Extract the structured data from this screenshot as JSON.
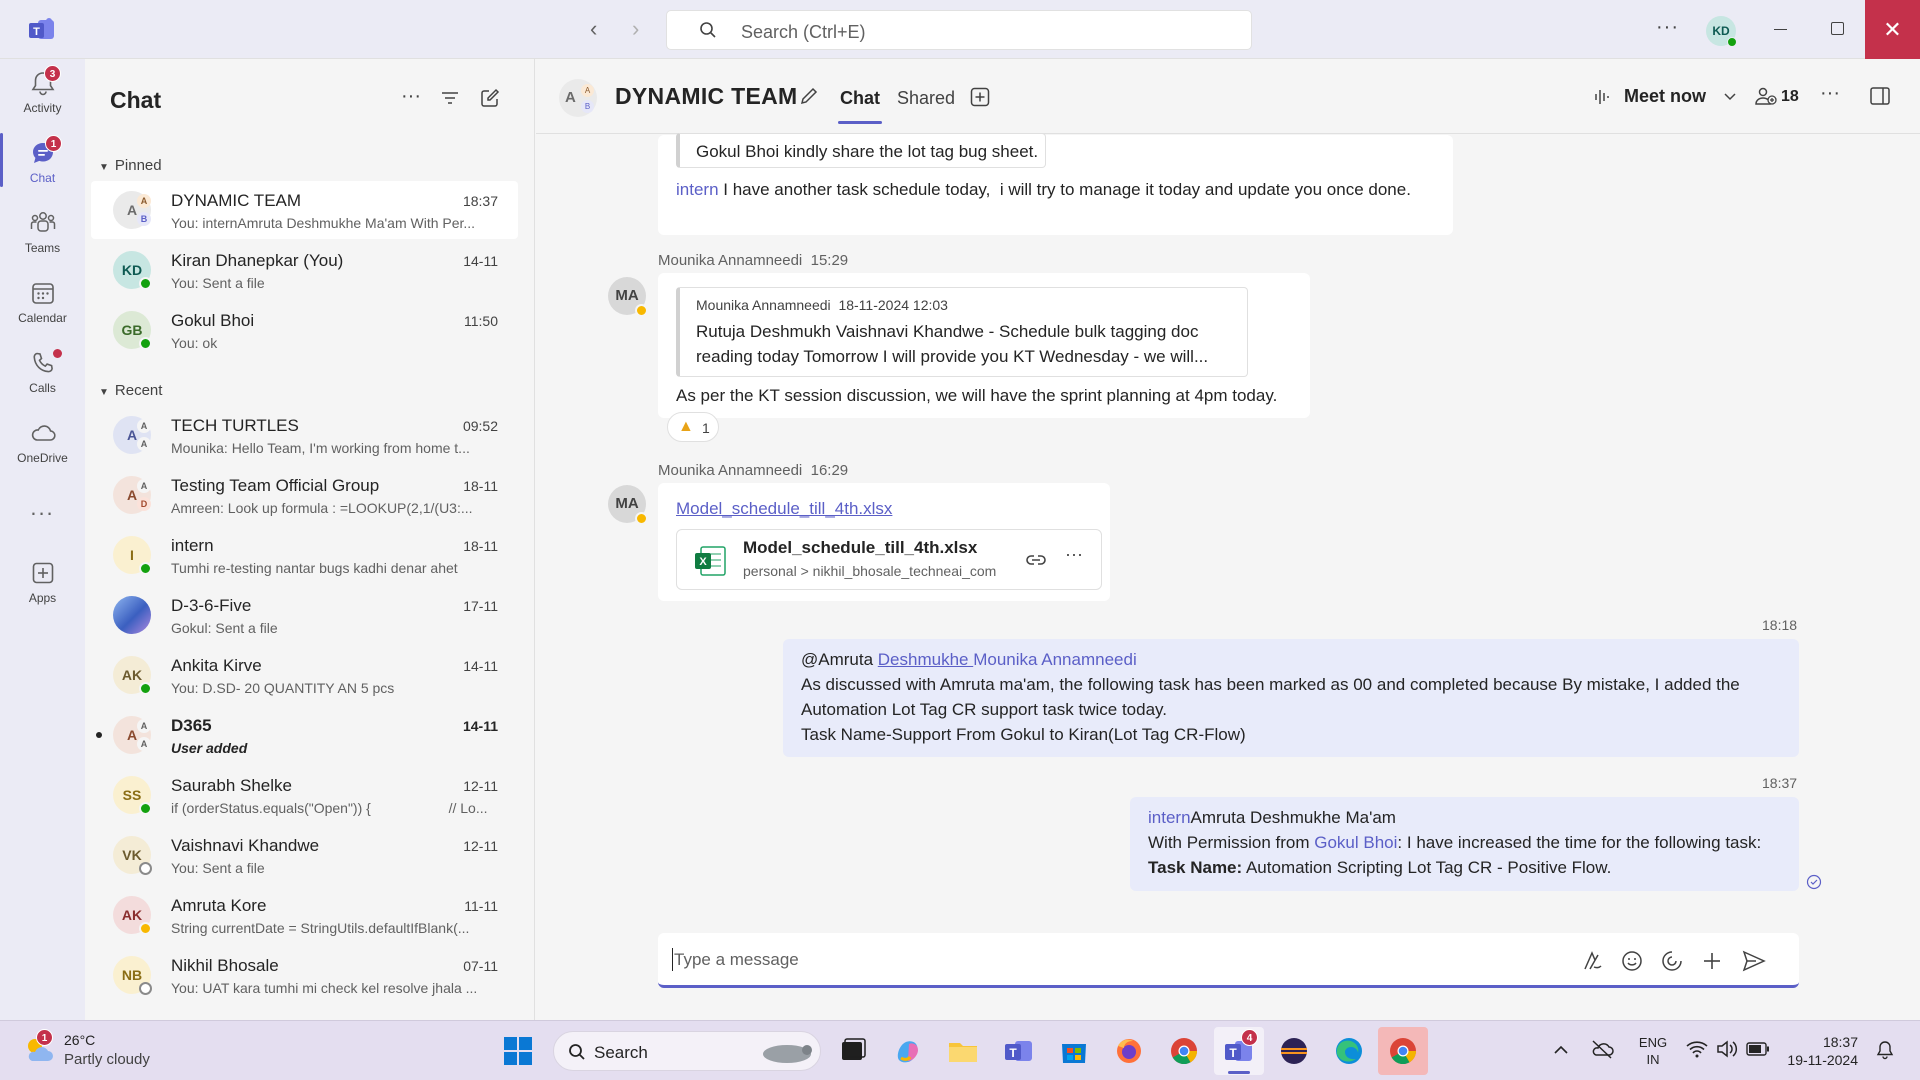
{
  "titlebar": {
    "search_placeholder": "Search (Ctrl+E)",
    "user_initials": "KD"
  },
  "rail": {
    "items": [
      {
        "label": "Activity",
        "badge": "3"
      },
      {
        "label": "Chat",
        "badge": "1"
      },
      {
        "label": "Teams"
      },
      {
        "label": "Calendar"
      },
      {
        "label": "Calls"
      },
      {
        "label": "OneDrive"
      },
      {
        "label": "Apps"
      }
    ],
    "more": "..."
  },
  "chatlist": {
    "title": "Chat",
    "pinned_label": "Pinned",
    "recent_label": "Recent",
    "pinned": [
      {
        "name": "DYNAMIC TEAM",
        "time": "18:37",
        "preview": "You: internAmruta Deshmukhe Ma'am With Per...",
        "initials": "A",
        "selected": true
      },
      {
        "name": "Kiran Dhanepkar (You)",
        "time": "14-11",
        "preview": "You: Sent a file",
        "initials": "KD"
      },
      {
        "name": "Gokul Bhoi",
        "time": "11:50",
        "preview": "You: ok",
        "initials": "GB"
      }
    ],
    "recent": [
      {
        "name": "TECH TURTLES",
        "time": "09:52",
        "preview": "Mounika: Hello Team, I'm working from home t...",
        "initials": "A"
      },
      {
        "name": "Testing Team Official Group",
        "time": "18-11",
        "preview": "Amreen: Look up formula : =LOOKUP(2,1/(U3:...",
        "initials": "A"
      },
      {
        "name": "intern",
        "time": "18-11",
        "preview": "Tumhi re-testing nantar bugs kadhi denar ahet",
        "initials": "I"
      },
      {
        "name": "D-3-6-Five",
        "time": "17-11",
        "preview": "Gokul: Sent a file",
        "initials": ""
      },
      {
        "name": "Ankita Kirve",
        "time": "14-11",
        "preview": "You: D.SD- 20 QUANTITY AN 5 pcs",
        "initials": "AK"
      },
      {
        "name": "D365",
        "time": "14-11",
        "preview": "User added",
        "initials": "A"
      },
      {
        "name": "Saurabh Shelke",
        "time": "12-11",
        "preview": "if (orderStatus.equals(\"Open\")) {                    // Lo...",
        "initials": "SS"
      },
      {
        "name": "Vaishnavi Khandwe",
        "time": "12-11",
        "preview": "You: Sent a file",
        "initials": "VK"
      },
      {
        "name": "Amruta Kore",
        "time": "11-11",
        "preview": "String currentDate = StringUtils.defaultIfBlank(...",
        "initials": "AK"
      },
      {
        "name": "Nikhil Bhosale",
        "time": "07-11",
        "preview": "You: UAT kara tumhi mi check kel resolve jhala ...",
        "initials": "NB"
      }
    ]
  },
  "header": {
    "title": "DYNAMIC TEAM",
    "tabs": [
      "Chat",
      "Shared"
    ],
    "meet_now": "Meet now",
    "people_count": "18"
  },
  "messages": {
    "m1": {
      "quote": "Gokul Bhoi kindly share the lot tag bug sheet.",
      "mention": "intern",
      "text": " I have another task schedule today,  i will try to manage it today and update you once done."
    },
    "m2": {
      "sender": "Mounika Annamneedi",
      "time": "15:29",
      "initials": "MA",
      "quote_sender": "Mounika Annamneedi",
      "quote_time": "18-11-2024 12:03",
      "quote_line1": "Rutuja Deshmukh Vaishnavi Khandwe - Schedule bulk tagging doc",
      "quote_line2": "reading today Tomorrow I will provide you KT Wednesday - we will...",
      "text": "As per the KT session discussion, we will have the sprint planning at 4pm today.",
      "reaction_count": "1"
    },
    "m3": {
      "sender": "Mounika Annamneedi",
      "time": "16:29",
      "initials": "MA",
      "link": "Model_schedule_till_4th.xlsx",
      "file_name": "Model_schedule_till_4th.xlsx",
      "file_path": "personal > nikhil_bhosale_techneai_com"
    },
    "m4": {
      "time": "18:18",
      "prefix": "@Amruta ",
      "mention1": "Deshmukhe ",
      "mention2": "Mounika Annamneedi",
      "line1": "As discussed with Amruta ma'am, the following task has been marked as 00 and completed because By mistake, I added the",
      "line2": "Automation Lot Tag CR support task twice today.",
      "line3": "Task Name-Support From Gokul to Kiran(Lot Tag CR-Flow)"
    },
    "m5": {
      "time": "18:37",
      "mention1": "intern",
      "line1_rest": "Amruta Deshmukhe Ma'am",
      "line2_pre": "With Permission from ",
      "mention2": "Gokul Bhoi",
      "line2_post": ": I have increased the time for the following task:",
      "task_label": "Task Name:",
      "task_value": " Automation Scripting Lot Tag CR - Positive Flow."
    }
  },
  "compose": {
    "placeholder": "Type a message"
  },
  "taskbar": {
    "weather_badge": "1",
    "temp": "26°C",
    "weather_desc": "Partly cloudy",
    "search_label": "Search",
    "teams_badge": "4",
    "lang1": "ENG",
    "lang2": "IN",
    "time": "18:37",
    "date": "19-11-2024"
  },
  "colors": {
    "accent": "#5b5fc7",
    "close": "#c4314b",
    "presence_green": "#13a10e"
  }
}
